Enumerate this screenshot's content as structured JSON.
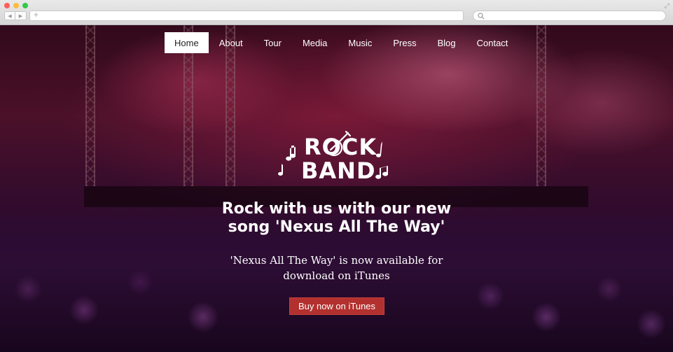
{
  "nav": {
    "items": [
      {
        "label": "Home",
        "active": true
      },
      {
        "label": "About"
      },
      {
        "label": "Tour"
      },
      {
        "label": "Media"
      },
      {
        "label": "Music"
      },
      {
        "label": "Press"
      },
      {
        "label": "Blog"
      },
      {
        "label": "Contact"
      }
    ]
  },
  "logo": {
    "line1": "ROCK",
    "line2": "BAND"
  },
  "hero": {
    "headline_line1": "Rock with us with our new",
    "headline_line2": "song 'Nexus All The Way'",
    "subline_line1": "'Nexus All The Way' is now available for",
    "subline_line2": "download on iTunes",
    "cta_label": "Buy now on iTunes"
  },
  "colors": {
    "cta_bg": "#b2302e",
    "nav_active_bg": "#ffffff",
    "text": "#ffffff"
  },
  "icons": {
    "logo_guitar": "guitar-icon",
    "logo_notes": "music-note-icon"
  }
}
